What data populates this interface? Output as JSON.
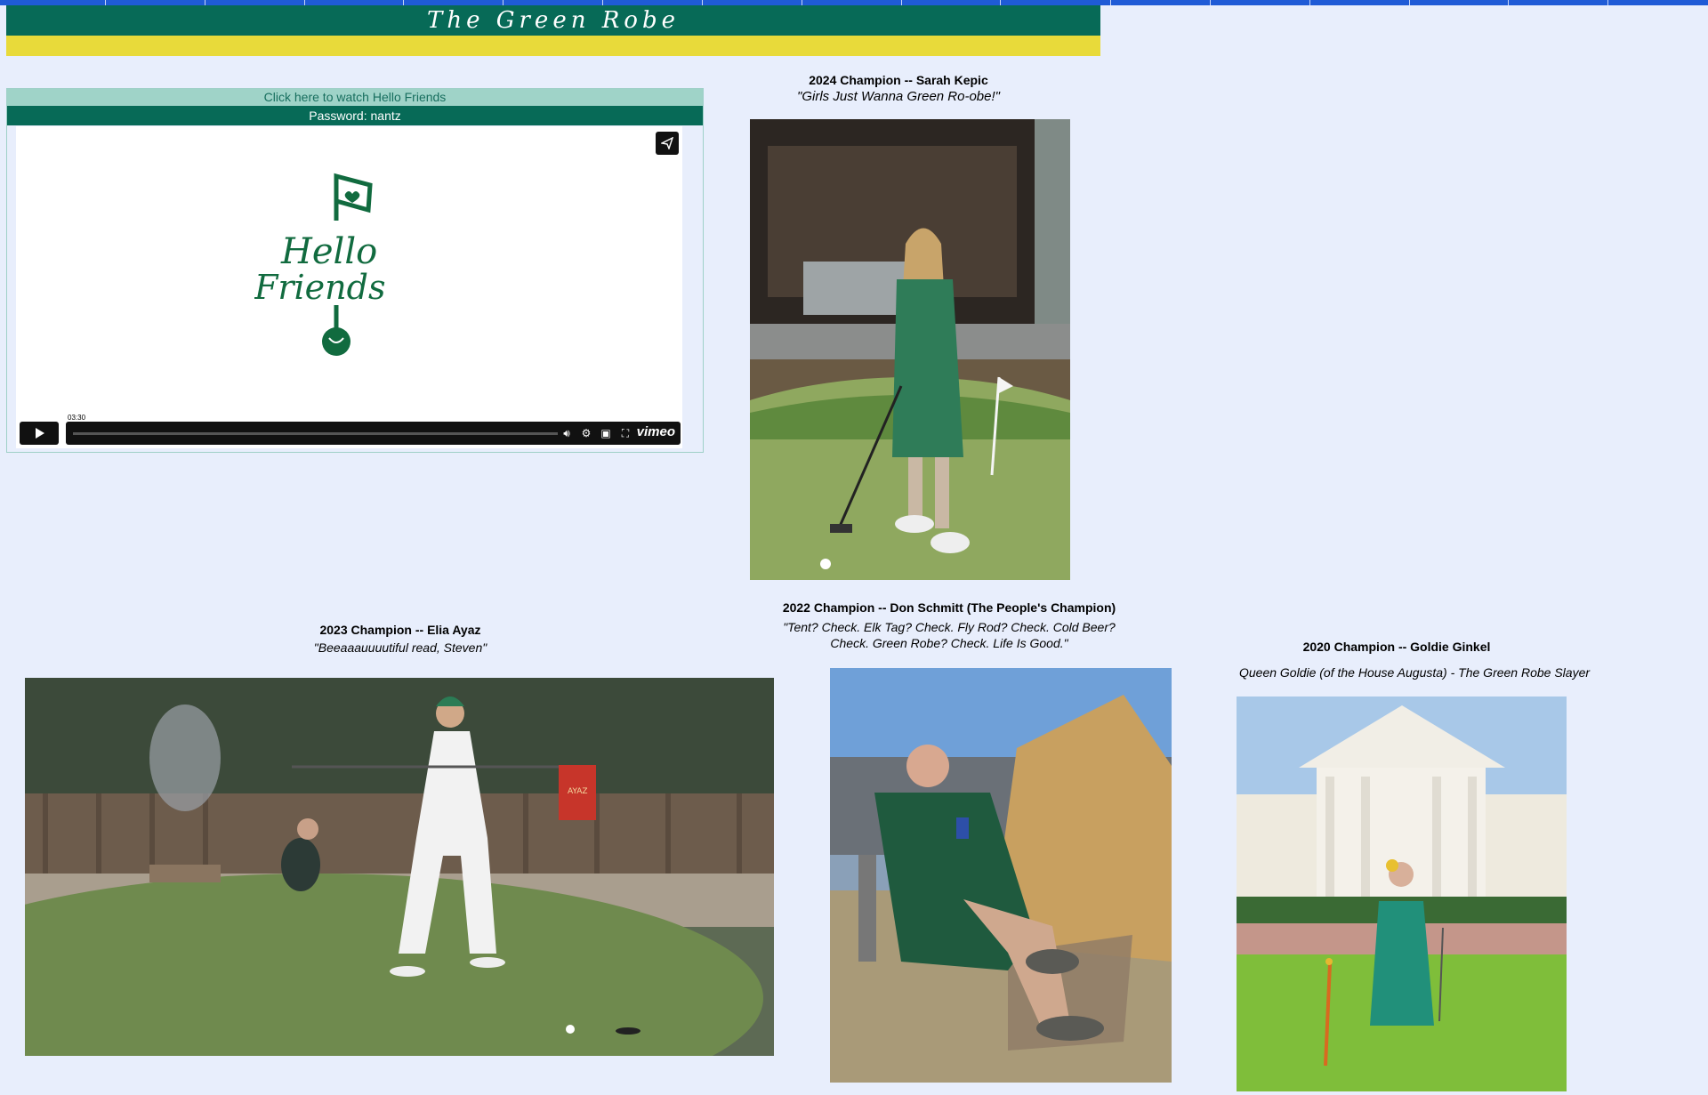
{
  "header": {
    "title": "The Green Robe"
  },
  "video": {
    "watch_link": "Click here to watch Hello Friends",
    "password": "Password: nantz",
    "logo_line1": "Hello",
    "logo_line2": "Friends",
    "time": "03:30",
    "brand": "vimeo"
  },
  "champions": [
    {
      "name": "2024 Champion -- Sarah Kepic",
      "quote": "\"Girls Just Wanna Green Ro-obe!\""
    },
    {
      "name": "2023 Champion -- Elia Ayaz",
      "quote": "\"Beeaaauuuutiful read, Steven\""
    },
    {
      "name": "2022 Champion -- Don Schmitt (The People's Champion)",
      "quote_line1": "\"Tent? Check. Elk Tag? Check. Fly Rod? Check. Cold Beer?",
      "quote_line2": "Check. Green Robe? Check. Life Is Good.\""
    },
    {
      "name": "2020 Champion -- Goldie Ginkel",
      "quote": "Queen Goldie (of the House Augusta) - The Green Robe Slayer"
    }
  ],
  "photos": {
    "p2024": "ayaz-jersey",
    "flag_text": "AYAZ"
  },
  "colors": {
    "brand_green": "#076a57",
    "brand_yellow": "#e8da3a",
    "page_bg": "#e8eefc",
    "nav_blue": "#1f5bd6"
  }
}
